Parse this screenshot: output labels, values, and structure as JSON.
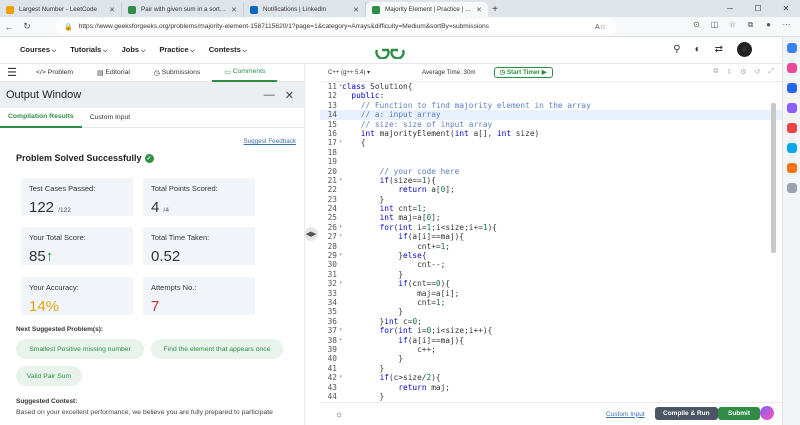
{
  "browser": {
    "tabs": [
      {
        "title": "Largest Number - LeetCode",
        "favicon_color": "#f0a000"
      },
      {
        "title": "Pair with given sum in a sorted a",
        "favicon_color": "#2f8d46"
      },
      {
        "title": "Notifications | LinkedIn",
        "favicon_color": "#0a66c2"
      },
      {
        "title": "Majority Element | Practice | Gee",
        "favicon_color": "#2f8d46"
      }
    ],
    "new_tab": "+",
    "url": "https://www.geeksforgeeks.org/problems/majority-element-1587115620/1?page=1&category=Arrays&difficulty=Medium&sortBy=submissions"
  },
  "site": {
    "nav": [
      "Courses",
      "Tutorials",
      "Jobs",
      "Practice",
      "Contests"
    ],
    "logo": "GG"
  },
  "problem_tabs": [
    "Problem",
    "Editorial",
    "Submissions",
    "Comments"
  ],
  "output": {
    "title": "Output Window",
    "subtabs": [
      "Compilation Results",
      "Custom Input"
    ],
    "suggest": "Suggest Feedback",
    "status": "Problem Solved Successfully",
    "cards": {
      "passed_label": "Test Cases Passed:",
      "passed_value": "122",
      "passed_total": "/122",
      "points_label": "Total Points Scored:",
      "points_value": "4",
      "points_total": "/4",
      "score_label": "Your Total Score:",
      "score_value": "85",
      "time_label": "Total Time Taken:",
      "time_value": "0.52",
      "accuracy_label": "Your Accuracy:",
      "accuracy_value": "14%",
      "attempts_label": "Attempts No.:",
      "attempts_value": "7"
    },
    "next_label": "Next Suggested Problem(s):",
    "next": [
      "Smallest Positive missing number",
      "Find the element that appears once",
      "Valid Pair Sum"
    ],
    "contest_label": "Suggested Contest:",
    "contest_text": "Based on your excellent performance, we believe you are fully prepared to participate"
  },
  "editor": {
    "language": "C++ (g++ 5.4)",
    "avg_time": "Average Time: 30m",
    "timer": "Start Timer",
    "lines": [
      {
        "n": "11",
        "f": "▾",
        "t": "class Solution{"
      },
      {
        "n": "12",
        "f": "",
        "t": "  public:"
      },
      {
        "n": "13",
        "f": "",
        "t": "    // Function to find majority element in the array"
      },
      {
        "n": "14",
        "f": "",
        "t": "    // a: input array",
        "hl": true
      },
      {
        "n": "15",
        "f": "",
        "t": "    // size: size of input array"
      },
      {
        "n": "16",
        "f": "",
        "t": "    int majorityElement(int a[], int size)"
      },
      {
        "n": "17",
        "f": "▾",
        "t": "    {"
      },
      {
        "n": "18",
        "f": "",
        "t": ""
      },
      {
        "n": "19",
        "f": "",
        "t": ""
      },
      {
        "n": "20",
        "f": "",
        "t": "        // your code here"
      },
      {
        "n": "21",
        "f": "▾",
        "t": "        if(size==1){"
      },
      {
        "n": "22",
        "f": "",
        "t": "            return a[0];"
      },
      {
        "n": "23",
        "f": "",
        "t": "        }"
      },
      {
        "n": "24",
        "f": "",
        "t": "        int cnt=1;"
      },
      {
        "n": "25",
        "f": "",
        "t": "        int maj=a[0];"
      },
      {
        "n": "26",
        "f": "▾",
        "t": "        for(int i=1;i<size;i+=1){"
      },
      {
        "n": "27",
        "f": "▾",
        "t": "            if(a[i]==maj){"
      },
      {
        "n": "28",
        "f": "",
        "t": "                cnt+=1;"
      },
      {
        "n": "29",
        "f": "▾",
        "t": "            }else{"
      },
      {
        "n": "30",
        "f": "",
        "t": "                cnt--;"
      },
      {
        "n": "31",
        "f": "",
        "t": "            }"
      },
      {
        "n": "32",
        "f": "▾",
        "t": "            if(cnt==0){"
      },
      {
        "n": "33",
        "f": "",
        "t": "                maj=a[i];"
      },
      {
        "n": "34",
        "f": "",
        "t": "                cnt=1;"
      },
      {
        "n": "35",
        "f": "",
        "t": "            }"
      },
      {
        "n": "36",
        "f": "",
        "t": "        }int c=0;"
      },
      {
        "n": "37",
        "f": "▾",
        "t": "        for(int i=0;i<size;i++){"
      },
      {
        "n": "38",
        "f": "▾",
        "t": "            if(a[i]==maj){"
      },
      {
        "n": "39",
        "f": "",
        "t": "                c++;"
      },
      {
        "n": "40",
        "f": "",
        "t": "            }"
      },
      {
        "n": "41",
        "f": "",
        "t": "        }"
      },
      {
        "n": "42",
        "f": "▾",
        "t": "        if(c>size/2){"
      },
      {
        "n": "43",
        "f": "",
        "t": "            return maj;"
      },
      {
        "n": "44",
        "f": "",
        "t": "        }"
      }
    ],
    "custom_input": "Custom Input",
    "compile": "Compile & Run",
    "submit": "Submit"
  },
  "colors": {
    "accent": "#2f8d46",
    "accuracy": "#e6a31a",
    "attempts": "#d32f2f"
  }
}
